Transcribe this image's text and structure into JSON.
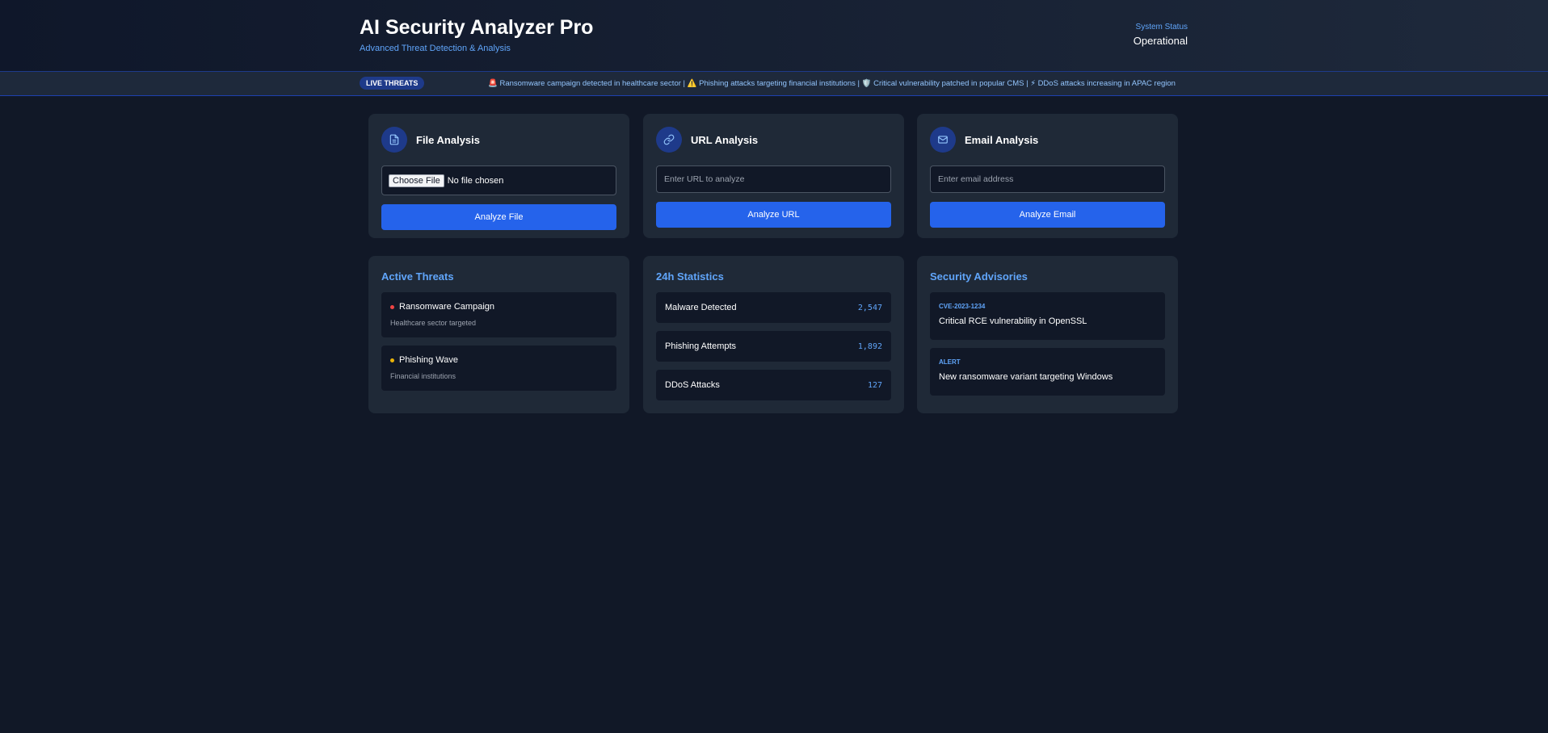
{
  "header": {
    "title": "AI Security Analyzer Pro",
    "subtitle": "Advanced Threat Detection & Analysis",
    "status_label": "System Status",
    "status_value": "Operational"
  },
  "ticker": {
    "badge": "LIVE THREATS",
    "text": "🚨 Ransomware campaign detected in healthcare sector | ⚠️ Phishing attacks targeting financial institutions | 🛡️ Critical vulnerability patched in popular CMS | ⚡ DDoS attacks increasing in APAC region"
  },
  "analysis": {
    "file": {
      "title": "File Analysis",
      "icon": "file-icon",
      "choose_label": "Choose File",
      "no_file_text": "No file chosen",
      "button": "Analyze File"
    },
    "url": {
      "title": "URL Analysis",
      "icon": "link-icon",
      "placeholder": "Enter URL to analyze",
      "value": "",
      "button": "Analyze URL"
    },
    "email": {
      "title": "Email Analysis",
      "icon": "mail-icon",
      "placeholder": "Enter email address",
      "value": "",
      "button": "Analyze Email"
    }
  },
  "active_threats": {
    "title": "Active Threats",
    "items": [
      {
        "name": "Ransomware Campaign",
        "desc": "Healthcare sector targeted",
        "color": "#ef4444"
      },
      {
        "name": "Phishing Wave",
        "desc": "Financial institutions",
        "color": "#eab308"
      }
    ]
  },
  "stats": {
    "title": "24h Statistics",
    "items": [
      {
        "label": "Malware Detected",
        "value": "2,547"
      },
      {
        "label": "Phishing Attempts",
        "value": "1,892"
      },
      {
        "label": "DDoS Attacks",
        "value": "127"
      }
    ]
  },
  "advisories": {
    "title": "Security Advisories",
    "items": [
      {
        "tag": "CVE-2023-1234",
        "text": "Critical RCE vulnerability in OpenSSL"
      },
      {
        "tag": "ALERT",
        "text": "New ransomware variant targeting Windows"
      }
    ]
  },
  "colors": {
    "accent": "#2563eb",
    "accent_text": "#60a5fa",
    "background": "#111827",
    "card": "#1f2937"
  }
}
